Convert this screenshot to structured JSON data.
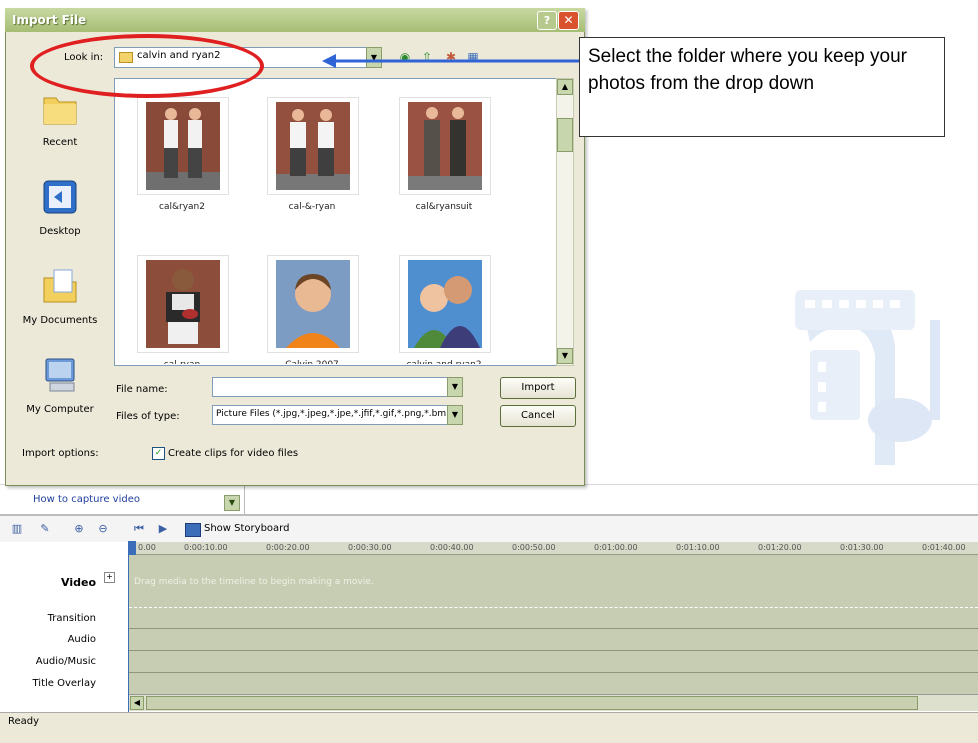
{
  "dialog": {
    "title": "Import File",
    "help_label": "?",
    "close_label": "✕",
    "look_in_label": "Look in:",
    "look_in_value": "calvin and ryan2",
    "places": [
      "Recent",
      "Desktop",
      "My Documents",
      "My Computer"
    ],
    "files": [
      {
        "name": "cal&ryan2"
      },
      {
        "name": "cal-&-ryan"
      },
      {
        "name": "cal&ryansuit"
      },
      {
        "name": "cal-ryan"
      },
      {
        "name": "Calvin 2007"
      },
      {
        "name": "calvin and ryan2"
      }
    ],
    "file_name_label": "File name:",
    "file_name_value": "",
    "files_of_type_label": "Files of type:",
    "files_of_type_value": "Picture Files (*.jpg,*.jpeg,*.jpe,*.jfif,*.gif,*.png,*.bmp)",
    "import_button": "Import",
    "cancel_button": "Cancel",
    "import_options_label": "Import options:",
    "create_clips_label": "Create clips for video files",
    "create_clips_checked": true
  },
  "annotation": {
    "callout_text": "Select the folder where you keep your photos from the drop down"
  },
  "app": {
    "capture_link": "How to capture video",
    "show_storyboard_label": "Show Storyboard",
    "timeline_ticks": [
      "0.00",
      "0:00:10.00",
      "0:00:20.00",
      "0:00:30.00",
      "0:00:40.00",
      "0:00:50.00",
      "0:01:00.00",
      "0:01:10.00",
      "0:01:20.00",
      "0:01:30.00",
      "0:01:40.00"
    ],
    "tracks": {
      "video": "Video",
      "transition": "Transition",
      "audio": "Audio",
      "audio_music": "Audio/Music",
      "title_overlay": "Title Overlay"
    },
    "timeline_hint": "Drag media to the timeline to begin making a movie.",
    "status": "Ready"
  }
}
